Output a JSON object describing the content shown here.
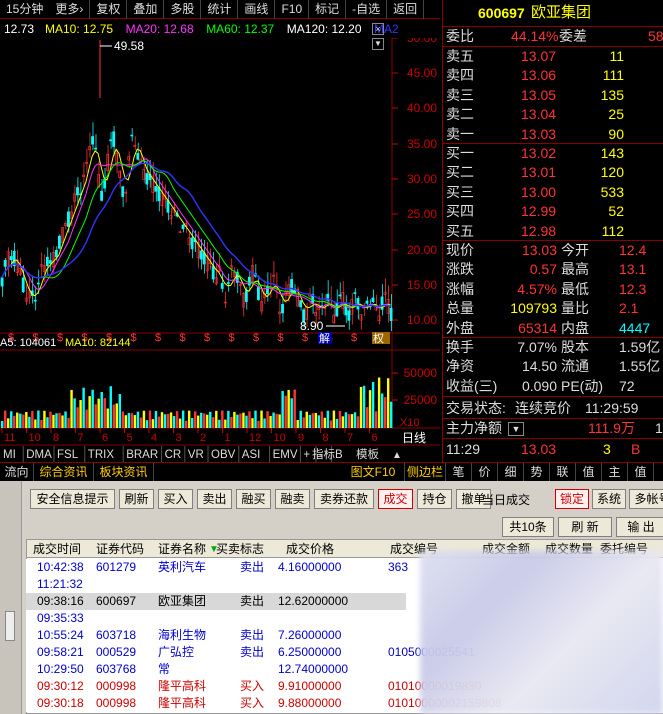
{
  "toolbar": {
    "items": [
      "15分钟",
      "更多›",
      "复权",
      "叠加",
      "多股",
      "统计",
      "画线",
      "F10",
      "标记",
      "-自选",
      "返回"
    ]
  },
  "chart_head": {
    "ma_values": [
      {
        "label": "12.73",
        "color": "#ffffff"
      },
      {
        "label": "MA10: 12.75",
        "color": "#ffff00"
      },
      {
        "label": "MA20: 12.68",
        "color": "#ff33ff"
      },
      {
        "label": "MA60: 12.37",
        "color": "#00ff00"
      },
      {
        "label": "MA120: 12.20",
        "color": "#ffffff"
      },
      {
        "label": "MA2",
        "color": "#3333ff"
      }
    ]
  },
  "price_axis": {
    "labels": [
      "50.00",
      "45.00",
      "40.00",
      "35.00",
      "30.00",
      "25.00",
      "20.00",
      "15.00",
      "10.00"
    ]
  },
  "annotations": {
    "high": "49.58",
    "low": "8.90",
    "jie": "解",
    "quan": "权"
  },
  "volume": {
    "head_label": "A5: 104061",
    "head_ma10": "MA10: 82144",
    "axis": [
      "50000",
      "25000"
    ],
    "unit": "X10"
  },
  "time_axis": [
    "11",
    "10",
    "8",
    "7",
    "6",
    "5",
    "4",
    "3",
    "2",
    "1",
    "12",
    "10",
    "9",
    "8",
    "7",
    "6"
  ],
  "line_label": "日线",
  "indicator_tabs": [
    "MI",
    "DMA",
    "FSL",
    "TRIX",
    "BRAR",
    "CR",
    "VR",
    "OBV",
    "ASI",
    "EMV",
    "+",
    "-"
  ],
  "indicator_right": {
    "zhibiao": "指标B",
    "moban": "模板",
    "arrow": "▲"
  },
  "stock": {
    "code": "600697",
    "name": "欧亚集团"
  },
  "weibi": {
    "label": "委比",
    "value": "44.14%",
    "label2": "委差",
    "value2": "58"
  },
  "asks": [
    {
      "label": "卖五",
      "price": "13.07",
      "vol": "11"
    },
    {
      "label": "卖四",
      "price": "13.06",
      "vol": "111"
    },
    {
      "label": "卖三",
      "price": "13.05",
      "vol": "135"
    },
    {
      "label": "卖二",
      "price": "13.04",
      "vol": "25"
    },
    {
      "label": "卖一",
      "price": "13.03",
      "vol": "90"
    }
  ],
  "bids": [
    {
      "label": "买一",
      "price": "13.02",
      "vol": "143"
    },
    {
      "label": "买二",
      "price": "13.01",
      "vol": "120"
    },
    {
      "label": "买三",
      "price": "13.00",
      "vol": "533"
    },
    {
      "label": "买四",
      "price": "12.99",
      "vol": "52"
    },
    {
      "label": "买五",
      "price": "12.98",
      "vol": "112"
    }
  ],
  "quote": [
    {
      "l1": "现价",
      "v1": "13.03",
      "l2": "今开",
      "v2": "12.4"
    },
    {
      "l1": "涨跌",
      "v1": "0.57",
      "l2": "最高",
      "v2": "13.1"
    },
    {
      "l1": "涨幅",
      "v1": "4.57%",
      "l2": "最低",
      "v2": "12.3"
    },
    {
      "l1": "总量",
      "v1": "109793",
      "l2": "量比",
      "v2": "2.1"
    },
    {
      "l1": "外盘",
      "v1": "65314",
      "l2": "内盘",
      "v2": "4447"
    }
  ],
  "quote2": [
    {
      "l1": "换手",
      "v1": "7.07%",
      "l2": "股本",
      "v2": "1.59亿"
    },
    {
      "l1": "净资",
      "v1": "14.50",
      "l2": "流通",
      "v2": "1.55亿"
    },
    {
      "l1": "收益(三)",
      "v1": "0.090",
      "l2": "PE(动)",
      "v2": "72"
    }
  ],
  "trade_status": {
    "label": "交易状态:",
    "value": "连续竞价",
    "time": "11:29:59"
  },
  "main_flow": {
    "label": "主力净额",
    "value": "111.9万",
    "suffix": "1"
  },
  "tick": {
    "time": "11:29",
    "price": "13.03",
    "vol": "3",
    "side": "B"
  },
  "lower_tabs_left": [
    "流向",
    "综合资讯",
    "板块资讯"
  ],
  "lower_tabs_right": [
    "图文F10",
    "侧边栏",
    "笔",
    "价",
    "细",
    "势",
    "联",
    "值",
    "主",
    "值"
  ],
  "buttons": [
    {
      "label": "安全信息提示"
    },
    {
      "label": "刷新"
    },
    {
      "label": "买入"
    },
    {
      "label": "卖出"
    },
    {
      "label": "融买"
    },
    {
      "label": "融卖"
    },
    {
      "label": "卖券还款"
    },
    {
      "label": "成交"
    },
    {
      "label": "持仓"
    },
    {
      "label": "撤单"
    }
  ],
  "today_deal": "当日成交",
  "right_buttons": [
    {
      "label": "锁定"
    },
    {
      "label": "系统"
    },
    {
      "label": "多帐号"
    }
  ],
  "count_label": "共10条",
  "refresh_label": "刷 新",
  "output_label": "输 出",
  "table": {
    "headers": [
      "成交时间",
      "证券代码",
      "证券名称",
      "买卖标志",
      "成交价格",
      "成交编号",
      "成交金额",
      "成交数量",
      "委托编号"
    ],
    "rows": [
      {
        "time": "10:42:38",
        "code": "601279",
        "name": "英利汽车",
        "side": "卖出",
        "price": "4.16000000",
        "no": "363",
        "color": "#00c"
      },
      {
        "time": "11:21:32",
        "code": "",
        "name": "",
        "side": "",
        "price": "",
        "no": "",
        "color": "#00c"
      },
      {
        "time": "09:38:16",
        "code": "600697",
        "name": "欧亚集团",
        "side": "卖出",
        "price": "12.62000000",
        "no": "",
        "color": "#000"
      },
      {
        "time": "09:35:33",
        "code": "",
        "name": "",
        "side": "",
        "price": "",
        "no": "",
        "color": "#00c"
      },
      {
        "time": "10:55:24",
        "code": "603718",
        "name": "海利生物",
        "side": "卖出",
        "price": "7.26000000",
        "no": "",
        "color": "#00c"
      },
      {
        "time": "09:58:21",
        "code": "000529",
        "name": "广弘控",
        "side": "卖出",
        "price": "6.25000000",
        "no": "0105000025541",
        "color": "#00c"
      },
      {
        "time": "10:29:50",
        "code": "603768",
        "name": "常",
        "side": "",
        "price": "12.74000000",
        "no": "",
        "color": "#00c"
      },
      {
        "time": "09:30:12",
        "code": "000998",
        "name": "隆平高科",
        "side": "买入",
        "price": "9.91000000",
        "no": "01010000019830",
        "color": "#c00"
      },
      {
        "time": "09:30:18",
        "code": "000998",
        "name": "隆平高科",
        "side": "买入",
        "price": "9.88000000",
        "no": "01010000002159808",
        "color": "#c00"
      }
    ]
  },
  "colors": {
    "up": "#ff3333",
    "down": "#00ffff",
    "accent": "#ffcc00",
    "ma5": "#ffffff",
    "ma10": "#ffff00",
    "ma20": "#ff33ff",
    "ma60": "#00ff00",
    "ma120": "#0000ff"
  }
}
